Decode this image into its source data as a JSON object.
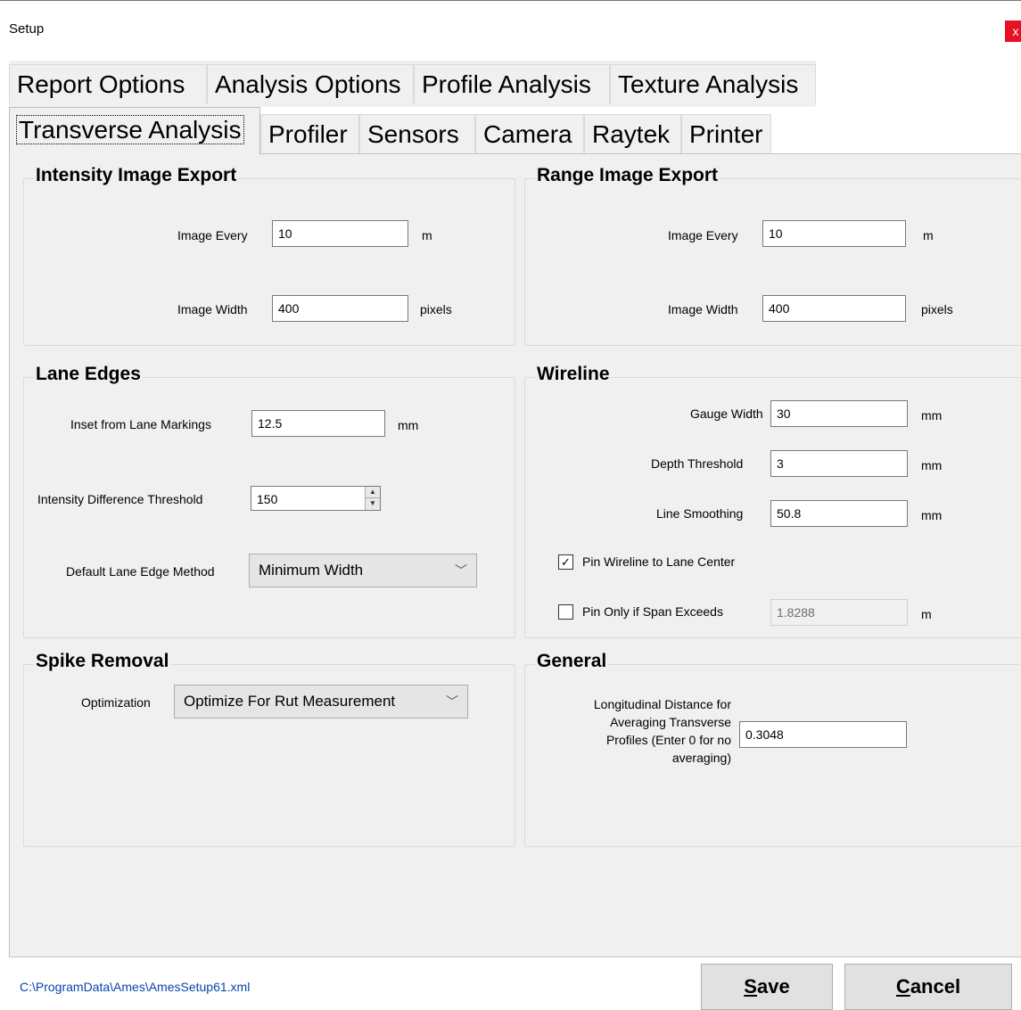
{
  "window": {
    "title": "Setup",
    "close": "x"
  },
  "tabs_row1": [
    {
      "label": "Report Options"
    },
    {
      "label": "Analysis Options"
    },
    {
      "label": "Profile Analysis"
    },
    {
      "label": "Texture Analysis"
    }
  ],
  "tabs_row2": [
    {
      "label": "Transverse Analysis",
      "active": true
    },
    {
      "label": "Profiler"
    },
    {
      "label": "Sensors"
    },
    {
      "label": "Camera"
    },
    {
      "label": "Raytek"
    },
    {
      "label": "Printer"
    }
  ],
  "intensity_export": {
    "title": "Intensity Image Export",
    "image_every_label": "Image Every",
    "image_every_value": "10",
    "image_every_unit": "m",
    "image_width_label": "Image Width",
    "image_width_value": "400",
    "image_width_unit": "pixels"
  },
  "range_export": {
    "title": "Range Image Export",
    "image_every_label": "Image Every",
    "image_every_value": "10",
    "image_every_unit": "m",
    "image_width_label": "Image Width",
    "image_width_value": "400",
    "image_width_unit": "pixels"
  },
  "lane_edges": {
    "title": "Lane Edges",
    "inset_label": "Inset from Lane Markings",
    "inset_value": "12.5",
    "inset_unit": "mm",
    "threshold_label": "Intensity Difference Threshold",
    "threshold_value": "150",
    "method_label": "Default Lane Edge Method",
    "method_value": "Minimum Width"
  },
  "wireline": {
    "title": "Wireline",
    "gauge_label": "Gauge Width",
    "gauge_value": "30",
    "gauge_unit": "mm",
    "depth_label": "Depth Threshold",
    "depth_value": "3",
    "depth_unit": "mm",
    "smoothing_label": "Line Smoothing",
    "smoothing_value": "50.8",
    "smoothing_unit": "mm",
    "pin_center_label": "Pin Wireline to Lane Center",
    "pin_center_checked": true,
    "pin_span_label": "Pin Only if Span Exceeds",
    "pin_span_checked": false,
    "pin_span_value": "1.8288",
    "pin_span_unit": "m"
  },
  "spike_removal": {
    "title": "Spike Removal",
    "optimization_label": "Optimization",
    "optimization_value": "Optimize For Rut Measurement"
  },
  "general": {
    "title": "General",
    "longitudinal_label_lines": [
      "Longitudinal Distance for",
      "Averaging Transverse",
      "Profiles (Enter 0 for no",
      "averaging)"
    ],
    "longitudinal_value": "0.3048"
  },
  "footer": {
    "path": "C:\\ProgramData\\Ames\\AmesSetup61.xml",
    "save_mnemonic": "S",
    "save_rest": "ave",
    "cancel_mnemonic": "C",
    "cancel_rest": "ancel"
  }
}
